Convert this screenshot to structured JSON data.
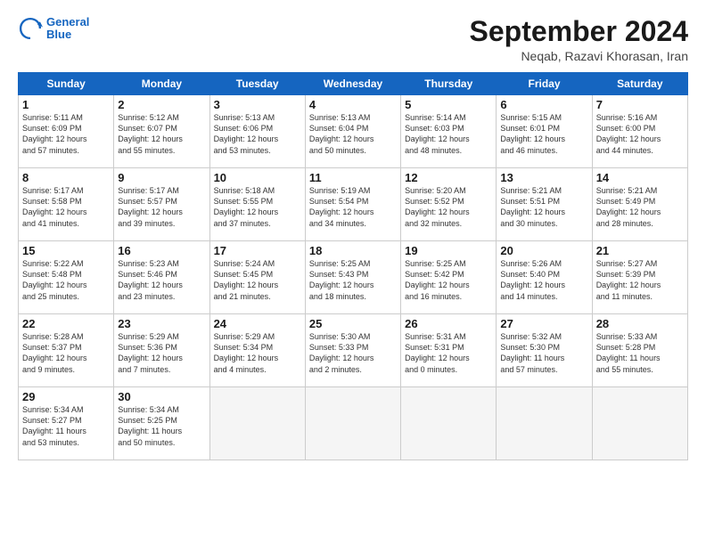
{
  "logo": {
    "line1": "General",
    "line2": "Blue"
  },
  "title": "September 2024",
  "location": "Neqab, Razavi Khorasan, Iran",
  "weekdays": [
    "Sunday",
    "Monday",
    "Tuesday",
    "Wednesday",
    "Thursday",
    "Friday",
    "Saturday"
  ],
  "weeks": [
    [
      {
        "day": "1",
        "info": "Sunrise: 5:11 AM\nSunset: 6:09 PM\nDaylight: 12 hours\nand 57 minutes."
      },
      {
        "day": "2",
        "info": "Sunrise: 5:12 AM\nSunset: 6:07 PM\nDaylight: 12 hours\nand 55 minutes."
      },
      {
        "day": "3",
        "info": "Sunrise: 5:13 AM\nSunset: 6:06 PM\nDaylight: 12 hours\nand 53 minutes."
      },
      {
        "day": "4",
        "info": "Sunrise: 5:13 AM\nSunset: 6:04 PM\nDaylight: 12 hours\nand 50 minutes."
      },
      {
        "day": "5",
        "info": "Sunrise: 5:14 AM\nSunset: 6:03 PM\nDaylight: 12 hours\nand 48 minutes."
      },
      {
        "day": "6",
        "info": "Sunrise: 5:15 AM\nSunset: 6:01 PM\nDaylight: 12 hours\nand 46 minutes."
      },
      {
        "day": "7",
        "info": "Sunrise: 5:16 AM\nSunset: 6:00 PM\nDaylight: 12 hours\nand 44 minutes."
      }
    ],
    [
      {
        "day": "8",
        "info": "Sunrise: 5:17 AM\nSunset: 5:58 PM\nDaylight: 12 hours\nand 41 minutes."
      },
      {
        "day": "9",
        "info": "Sunrise: 5:17 AM\nSunset: 5:57 PM\nDaylight: 12 hours\nand 39 minutes."
      },
      {
        "day": "10",
        "info": "Sunrise: 5:18 AM\nSunset: 5:55 PM\nDaylight: 12 hours\nand 37 minutes."
      },
      {
        "day": "11",
        "info": "Sunrise: 5:19 AM\nSunset: 5:54 PM\nDaylight: 12 hours\nand 34 minutes."
      },
      {
        "day": "12",
        "info": "Sunrise: 5:20 AM\nSunset: 5:52 PM\nDaylight: 12 hours\nand 32 minutes."
      },
      {
        "day": "13",
        "info": "Sunrise: 5:21 AM\nSunset: 5:51 PM\nDaylight: 12 hours\nand 30 minutes."
      },
      {
        "day": "14",
        "info": "Sunrise: 5:21 AM\nSunset: 5:49 PM\nDaylight: 12 hours\nand 28 minutes."
      }
    ],
    [
      {
        "day": "15",
        "info": "Sunrise: 5:22 AM\nSunset: 5:48 PM\nDaylight: 12 hours\nand 25 minutes."
      },
      {
        "day": "16",
        "info": "Sunrise: 5:23 AM\nSunset: 5:46 PM\nDaylight: 12 hours\nand 23 minutes."
      },
      {
        "day": "17",
        "info": "Sunrise: 5:24 AM\nSunset: 5:45 PM\nDaylight: 12 hours\nand 21 minutes."
      },
      {
        "day": "18",
        "info": "Sunrise: 5:25 AM\nSunset: 5:43 PM\nDaylight: 12 hours\nand 18 minutes."
      },
      {
        "day": "19",
        "info": "Sunrise: 5:25 AM\nSunset: 5:42 PM\nDaylight: 12 hours\nand 16 minutes."
      },
      {
        "day": "20",
        "info": "Sunrise: 5:26 AM\nSunset: 5:40 PM\nDaylight: 12 hours\nand 14 minutes."
      },
      {
        "day": "21",
        "info": "Sunrise: 5:27 AM\nSunset: 5:39 PM\nDaylight: 12 hours\nand 11 minutes."
      }
    ],
    [
      {
        "day": "22",
        "info": "Sunrise: 5:28 AM\nSunset: 5:37 PM\nDaylight: 12 hours\nand 9 minutes."
      },
      {
        "day": "23",
        "info": "Sunrise: 5:29 AM\nSunset: 5:36 PM\nDaylight: 12 hours\nand 7 minutes."
      },
      {
        "day": "24",
        "info": "Sunrise: 5:29 AM\nSunset: 5:34 PM\nDaylight: 12 hours\nand 4 minutes."
      },
      {
        "day": "25",
        "info": "Sunrise: 5:30 AM\nSunset: 5:33 PM\nDaylight: 12 hours\nand 2 minutes."
      },
      {
        "day": "26",
        "info": "Sunrise: 5:31 AM\nSunset: 5:31 PM\nDaylight: 12 hours\nand 0 minutes."
      },
      {
        "day": "27",
        "info": "Sunrise: 5:32 AM\nSunset: 5:30 PM\nDaylight: 11 hours\nand 57 minutes."
      },
      {
        "day": "28",
        "info": "Sunrise: 5:33 AM\nSunset: 5:28 PM\nDaylight: 11 hours\nand 55 minutes."
      }
    ],
    [
      {
        "day": "29",
        "info": "Sunrise: 5:34 AM\nSunset: 5:27 PM\nDaylight: 11 hours\nand 53 minutes."
      },
      {
        "day": "30",
        "info": "Sunrise: 5:34 AM\nSunset: 5:25 PM\nDaylight: 11 hours\nand 50 minutes."
      },
      {
        "day": "",
        "info": ""
      },
      {
        "day": "",
        "info": ""
      },
      {
        "day": "",
        "info": ""
      },
      {
        "day": "",
        "info": ""
      },
      {
        "day": "",
        "info": ""
      }
    ]
  ]
}
